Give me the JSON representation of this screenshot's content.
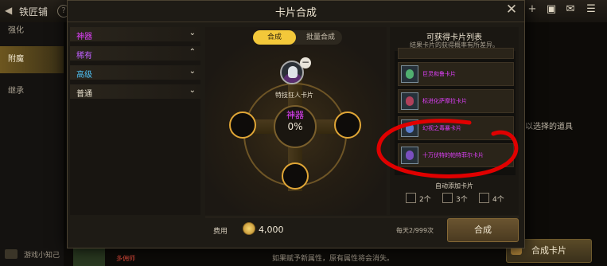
{
  "window": {
    "title": "铁匠铺",
    "help": "?"
  },
  "left_tabs": [
    "强化",
    "附魔",
    "继承"
  ],
  "tip": "游戏小知己",
  "background": {
    "right_text": "以选择的道具",
    "right_button": "合成卡片",
    "warning": "如果赋予新属性，原有属性将会消失。",
    "item_label": "多佣师"
  },
  "dialog": {
    "title": "卡片合成",
    "close": "✕",
    "tabs": {
      "synthesize": "合成",
      "batch": "批量合成"
    },
    "grades": [
      {
        "label": "神器",
        "color": "#e040fb",
        "chevron": "⌄"
      },
      {
        "label": "稀有",
        "color": "#c060ff",
        "chevron": "⌃"
      },
      {
        "label": "高级",
        "color": "#4fc3f7",
        "chevron": "⌄"
      },
      {
        "label": "普通",
        "color": "#e8e0cd",
        "chevron": "⌄"
      }
    ],
    "center": {
      "card_label": "特技狂人卡片",
      "grade": "神器",
      "percent": "0%",
      "remove": "−"
    },
    "list": {
      "title": "可获得卡片列表",
      "subtitle": "结果卡片的获得概率有所差异。",
      "cards": [
        "巨灵和鲁卡片",
        "标进化萨摩拉卡片",
        "幻视之毒暴卡片",
        "十万伏特的帕特菲尔卡片"
      ]
    },
    "auto_add": {
      "title": "自动添加卡片",
      "options": [
        "2个",
        "3个",
        "4个"
      ]
    },
    "footer": {
      "cost_label": "费用",
      "cost": "4,000",
      "daily": "每天2/999次",
      "button": "合成"
    }
  },
  "colors": {
    "accent": "#f3c83a",
    "annotation": "#e00000"
  },
  "icons": [
    "back-icon",
    "help-icon",
    "coin-icon",
    "close-icon",
    "chevron-icon",
    "card-thumb-icon"
  ]
}
